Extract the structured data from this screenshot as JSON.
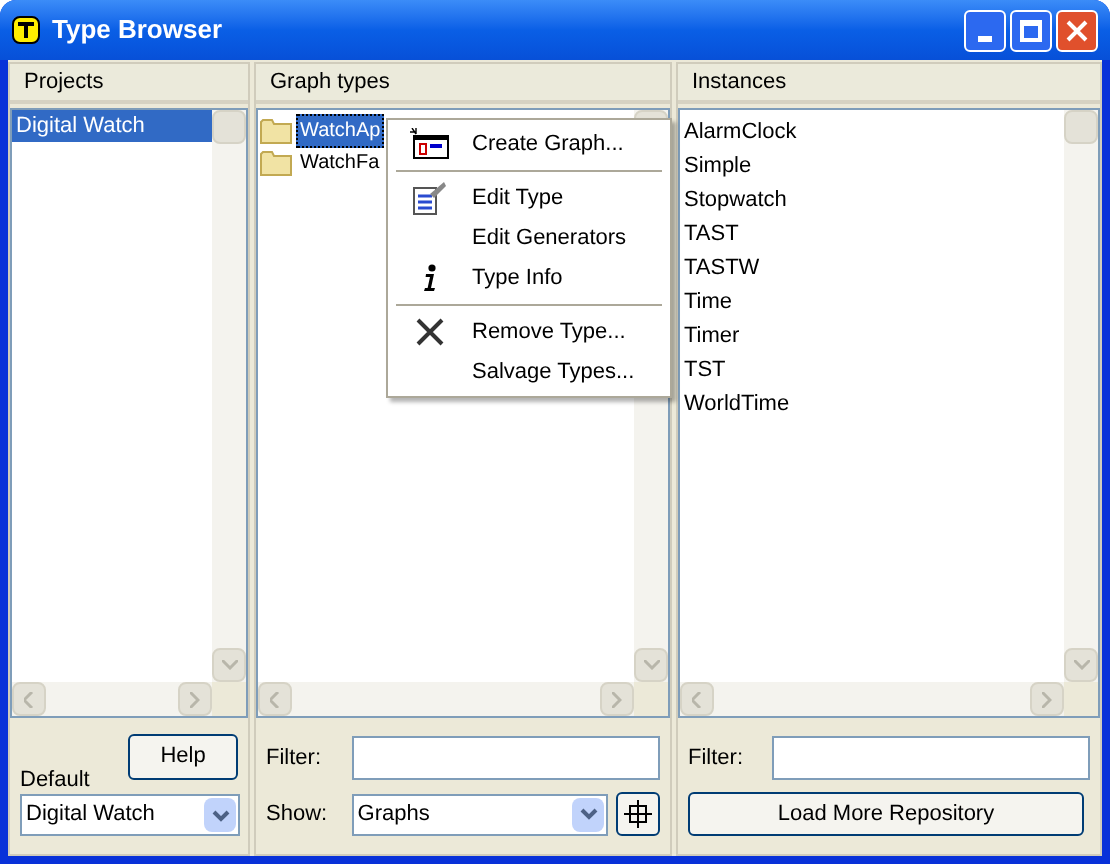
{
  "window": {
    "title": "Type Browser"
  },
  "projects": {
    "header": "Projects",
    "items": [
      {
        "label": "Digital Watch",
        "selected": true
      }
    ],
    "default_label": "Default",
    "help_button": "Help",
    "default_select": "Digital Watch"
  },
  "graph_types": {
    "header": "Graph types",
    "items": [
      {
        "label": "WatchAp",
        "selected": true
      },
      {
        "label": "WatchFa",
        "selected": false
      }
    ],
    "filter_label": "Filter:",
    "show_label": "Show:",
    "show_select": "Graphs"
  },
  "instances": {
    "header": "Instances",
    "items": [
      {
        "label": "AlarmClock"
      },
      {
        "label": "Simple"
      },
      {
        "label": "Stopwatch"
      },
      {
        "label": "TAST"
      },
      {
        "label": "TASTW"
      },
      {
        "label": "Time"
      },
      {
        "label": "Timer"
      },
      {
        "label": "TST"
      },
      {
        "label": "WorldTime"
      }
    ],
    "filter_label": "Filter:",
    "load_button": "Load More Repository"
  },
  "context_menu": {
    "groups": [
      [
        {
          "label": "Create Graph...",
          "kind": "create"
        }
      ],
      [
        {
          "label": "Edit Type",
          "kind": "edit"
        },
        {
          "label": "Edit Generators",
          "kind": "plain"
        },
        {
          "label": "Type Info",
          "kind": "info"
        }
      ],
      [
        {
          "label": "Remove Type...",
          "kind": "remove"
        },
        {
          "label": "Salvage Types...",
          "kind": "plain"
        }
      ]
    ]
  }
}
